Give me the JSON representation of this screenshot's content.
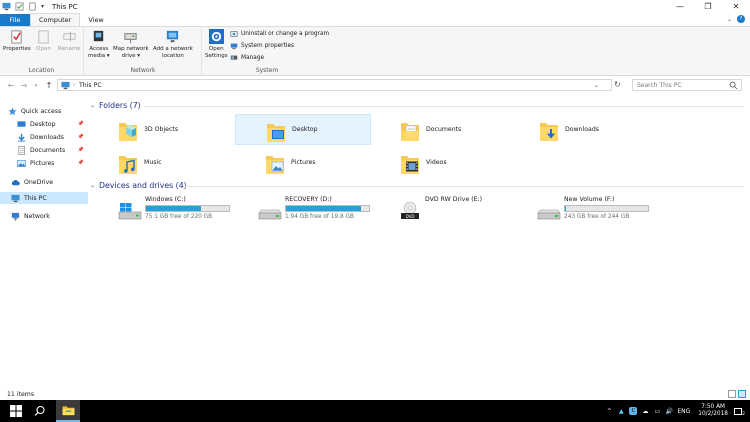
{
  "window": {
    "title": "This PC"
  },
  "tabs": {
    "file": "File",
    "computer": "Computer",
    "view": "View"
  },
  "ribbon": {
    "location": {
      "label": "Location",
      "properties": "Properties",
      "open": "Open",
      "rename": "Rename"
    },
    "network": {
      "label": "Network",
      "access_media": "Access\nmedia ▾",
      "map_drive": "Map network\ndrive ▾",
      "add_location": "Add a network\nlocation"
    },
    "system": {
      "label": "System",
      "open_settings": "Open\nSettings",
      "uninstall": "Uninstall or change a program",
      "system_properties": "System properties",
      "manage": "Manage"
    }
  },
  "address": {
    "path": "This PC",
    "search_placeholder": "Search This PC"
  },
  "nav": {
    "quick_access": "Quick access",
    "desktop": "Desktop",
    "downloads": "Downloads",
    "documents": "Documents",
    "pictures": "Pictures",
    "onedrive": "OneDrive",
    "this_pc": "This PC",
    "network": "Network"
  },
  "folders": {
    "header": "Folders (7)",
    "items": [
      "3D Objects",
      "Desktop",
      "Documents",
      "Downloads",
      "Music",
      "Pictures",
      "Videos"
    ]
  },
  "drives": {
    "header": "Devices and drives (4)",
    "items": [
      {
        "name": "Windows (C:)",
        "free": "75.1 GB free of 220 GB",
        "used_fraction": 0.66
      },
      {
        "name": "RECOVERY (D:)",
        "free": "1.94 GB free of 19.8 GB",
        "used_fraction": 0.9
      },
      {
        "name": "DVD RW Drive (E:)",
        "free": ""
      },
      {
        "name": "New Volume (F:)",
        "free": "243 GB free of 244 GB",
        "used_fraction": 0.004
      }
    ]
  },
  "status": {
    "count": "11 items"
  },
  "taskbar": {
    "lang": "ENG",
    "time": "7:50 AM",
    "date": "10/2/2018",
    "notif_count": "2"
  },
  "colors": {
    "accent": "#1979ca",
    "selection": "#cce8ff",
    "drive_bar": "#26a0da",
    "section_header": "#1e3287"
  }
}
